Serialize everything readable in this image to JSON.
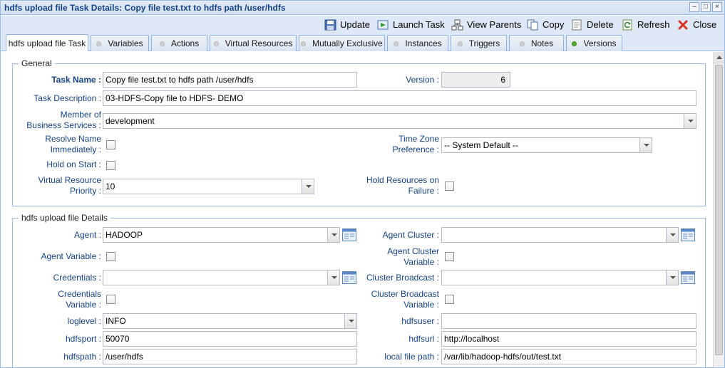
{
  "window": {
    "title": "hdfs upload file Task Details: Copy file test.txt to hdfs path /user/hdfs",
    "controls": [
      "minimize-icon",
      "maximize-icon",
      "close-icon"
    ]
  },
  "toolbar": {
    "update": "Update",
    "launch_task": "Launch Task",
    "view_parents": "View Parents",
    "copy": "Copy",
    "delete": "Delete",
    "refresh": "Refresh",
    "close": "Close"
  },
  "tabs": [
    {
      "label": "hdfs upload file Task",
      "active": true
    },
    {
      "label": "Variables"
    },
    {
      "label": "Actions"
    },
    {
      "label": "Virtual Resources"
    },
    {
      "label": "Mutually Exclusive"
    },
    {
      "label": "Instances"
    },
    {
      "label": "Triggers"
    },
    {
      "label": "Notes"
    },
    {
      "label": "Versions",
      "status": "green"
    }
  ],
  "general": {
    "legend": "General",
    "task_name_label": "Task Name :",
    "task_name": "Copy file test.txt to hdfs path /user/hdfs",
    "version_label": "Version :",
    "version": "6",
    "description_label": "Task Description :",
    "description": "03-HDFS-Copy file to HDFS- DEMO",
    "member_label_1": "Member of",
    "member_label_2": "Business Services :",
    "member": "development",
    "resolve_label_1": "Resolve Name",
    "resolve_label_2": "Immediately :",
    "timezone_label_1": "Time Zone",
    "timezone_label_2": "Preference :",
    "timezone": "-- System Default --",
    "hold_label": "Hold on Start :",
    "vr_priority_label_1": "Virtual Resource",
    "vr_priority_label_2": "Priority :",
    "vr_priority": "10",
    "hold_res_label_1": "Hold Resources on",
    "hold_res_label_2": "Failure :"
  },
  "details": {
    "legend": "hdfs upload file Details",
    "agent_label": "Agent :",
    "agent": "HADOOP",
    "agent_cluster_label": "Agent Cluster :",
    "agent_cluster": "",
    "agent_variable_label": "Agent Variable :",
    "agent_cluster_var_label_1": "Agent Cluster",
    "agent_cluster_var_label_2": "Variable :",
    "credentials_label": "Credentials :",
    "credentials": "",
    "cluster_broadcast_label": "Cluster Broadcast :",
    "cluster_broadcast": "",
    "cred_var_label_1": "Credentials",
    "cred_var_label_2": "Variable :",
    "cluster_bc_var_label_1": "Cluster Broadcast",
    "cluster_bc_var_label_2": "Variable :",
    "loglevel_label": "loglevel :",
    "loglevel": "INFO",
    "hdfsuser_label": "hdfsuser :",
    "hdfsuser": "",
    "hdfsport_label": "hdfsport :",
    "hdfsport": "50070",
    "hdfsurl_label": "hdfsurl :",
    "hdfsurl": "http://localhost",
    "hdfspath_label": "hdfspath :",
    "hdfspath": "/user/hdfs",
    "localpath_label": "local file path :",
    "localpath": "/var/lib/hadoop-hdfs/out/test.txt"
  }
}
